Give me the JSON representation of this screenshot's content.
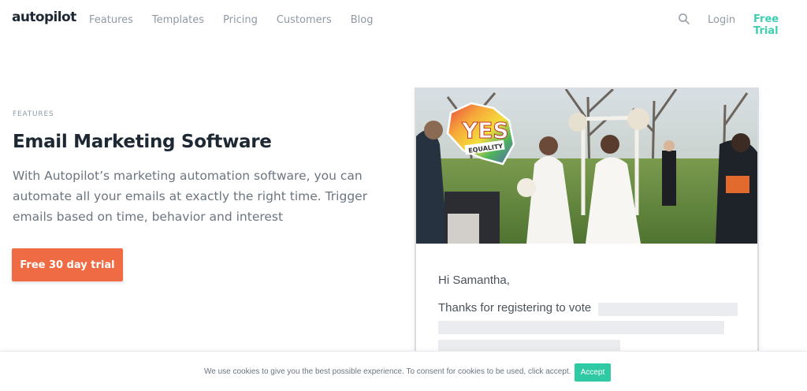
{
  "nav": {
    "logo": "autopilot",
    "links": [
      "Features",
      "Templates",
      "Pricing",
      "Customers",
      "Blog"
    ],
    "login": "Login",
    "free_trial": "Free Trial"
  },
  "hero": {
    "eyebrow": "FEATURES",
    "title": "Email Marketing Software",
    "description": "With Autopilot’s marketing automation software, you can automate all your emails at exactly the right time. Trigger emails based on time, behavior and interest",
    "cta": "Free 30 day trial"
  },
  "email_preview": {
    "badge_main": "YES",
    "badge_sub": "EQUALITY",
    "greeting": "Hi Samantha,",
    "body_line": "Thanks for registering to vote"
  },
  "cookie": {
    "text": "We use cookies to give you the best possible experience. To consent for cookies to be used, click accept.",
    "accept": "Accept"
  },
  "colors": {
    "brand_teal": "#3ecfb0",
    "cta_orange": "#ef6b43",
    "accept_green": "#2fc9a4"
  },
  "icons": [
    "search-icon"
  ]
}
